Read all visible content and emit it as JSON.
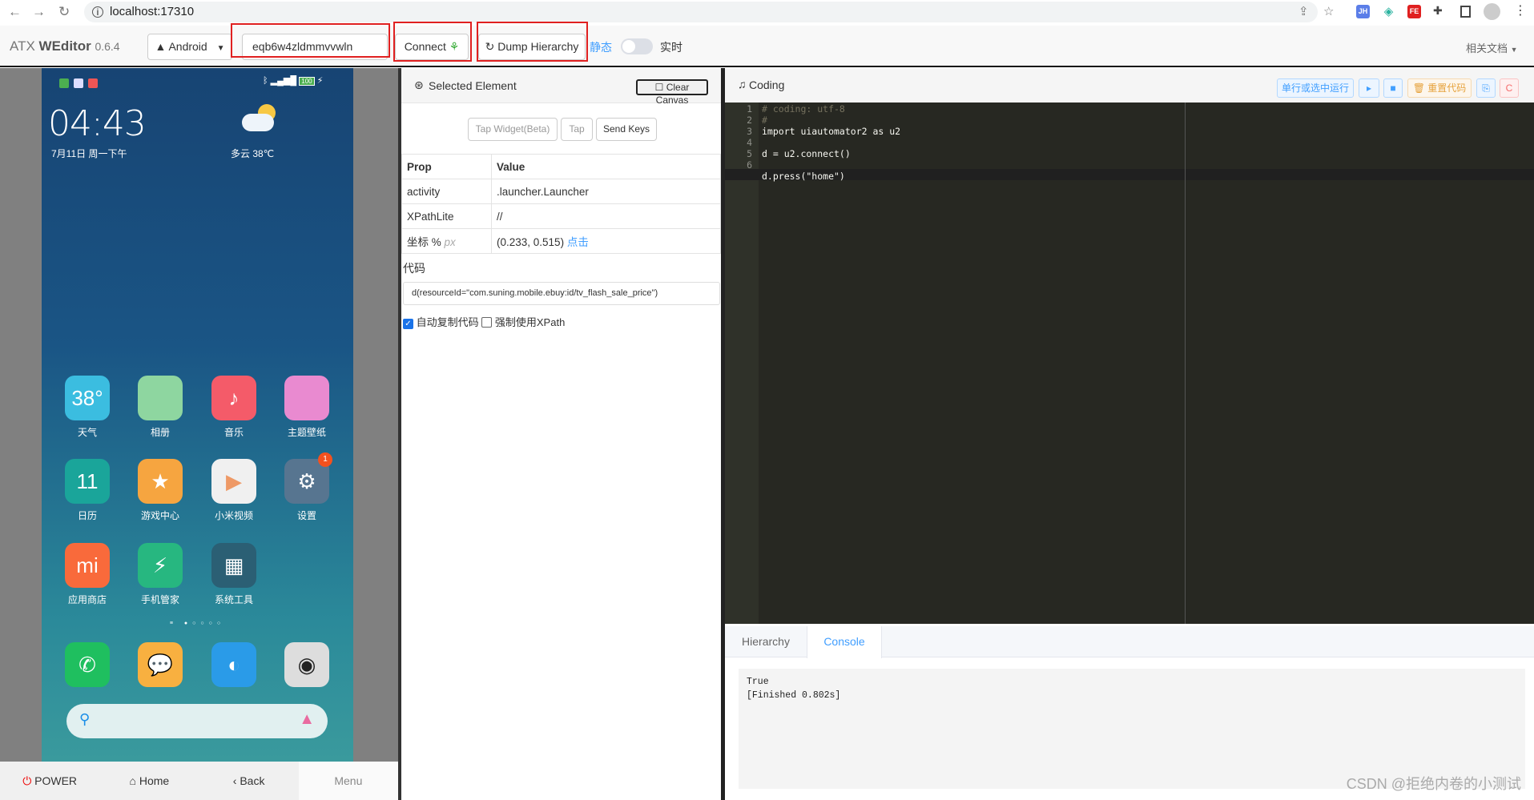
{
  "browser": {
    "url": "localhost:17310",
    "extensions": [
      "JH",
      "FE"
    ]
  },
  "app": {
    "brand_prefix": "ATX",
    "brand_name": "WEditor",
    "version": "0.6.4",
    "platform": "Android",
    "device_serial": "eqb6w4zldmmvvwln",
    "connect_label": "Connect",
    "dump_label": "Dump Hierarchy",
    "mode_static": "静态",
    "mode_realtime": "实时",
    "realtime_on": false,
    "docs_label": "相关文档"
  },
  "phone": {
    "time": "04:43",
    "date": "7月11日 周一下午",
    "weather": "多云  38℃",
    "battery": "100",
    "apps": [
      {
        "label": "天气",
        "text": "38°",
        "color": "#3bbde0"
      },
      {
        "label": "相册",
        "text": "",
        "color": "#8ed6a0"
      },
      {
        "label": "音乐",
        "text": "♪",
        "color": "#f45b69"
      },
      {
        "label": "主题壁纸",
        "text": "",
        "color": "#e98ad0"
      },
      {
        "label": "日历",
        "text": "11",
        "color": "#1aa59a"
      },
      {
        "label": "游戏中心",
        "text": "★",
        "color": "#f6a540"
      },
      {
        "label": "小米视频",
        "text": "▶",
        "color": "#f0f0f0"
      },
      {
        "label": "设置",
        "text": "⚙",
        "color": "#577590",
        "badge": "1"
      },
      {
        "label": "应用商店",
        "text": "mi",
        "color": "#f96a3b"
      },
      {
        "label": "手机管家",
        "text": "⚡",
        "color": "#27b780"
      },
      {
        "label": "系统工具",
        "text": "▦",
        "color": "#2b5f74"
      }
    ],
    "dock": [
      {
        "name": "phone",
        "text": "✆",
        "color": "#1fbf5f"
      },
      {
        "name": "messages",
        "text": "💬",
        "color": "#f8b040"
      },
      {
        "name": "browser",
        "text": "◐",
        "color": "#2a9be8"
      },
      {
        "name": "camera",
        "text": "◉",
        "color": "#ddd"
      }
    ],
    "page_count": 5,
    "page_active": 1
  },
  "controls": {
    "power": "POWER",
    "home": "Home",
    "back": "Back",
    "menu": "Menu"
  },
  "selected": {
    "title": "Selected Element",
    "clear_canvas": "Clear Canvas",
    "tap_widget": "Tap Widget(Beta)",
    "tap": "Tap",
    "send_keys": "Send Keys",
    "header_prop": "Prop",
    "header_value": "Value",
    "rows": [
      {
        "prop": "activity",
        "value": ".launcher.Launcher"
      },
      {
        "prop": "XPathLite",
        "value": "//"
      }
    ],
    "coord_label": "坐标 %",
    "coord_unit": "px",
    "coord_value": "(0.233, 0.515)",
    "coord_click": "点击",
    "code_label": "代码",
    "code_value": "d(resourceId=\"com.suning.mobile.ebuy:id/tv_flash_sale_price\")",
    "auto_copy": "自动复制代码",
    "auto_copy_checked": true,
    "force_xpath": "强制使用XPath",
    "force_xpath_checked": false
  },
  "coding": {
    "title": "Coding",
    "run_line": "单行或选中运行",
    "reset_code": "重置代码",
    "lines": [
      "# coding: utf-8",
      "#",
      "import uiautomator2 as u2",
      "",
      "d = u2.connect()",
      "",
      "d.press(\"home\")"
    ]
  },
  "tabs": {
    "hierarchy": "Hierarchy",
    "console": "Console",
    "active": "Console"
  },
  "console": {
    "output": "True\n[Finished 0.802s]"
  },
  "watermark": "CSDN @拒绝内卷的小测试"
}
